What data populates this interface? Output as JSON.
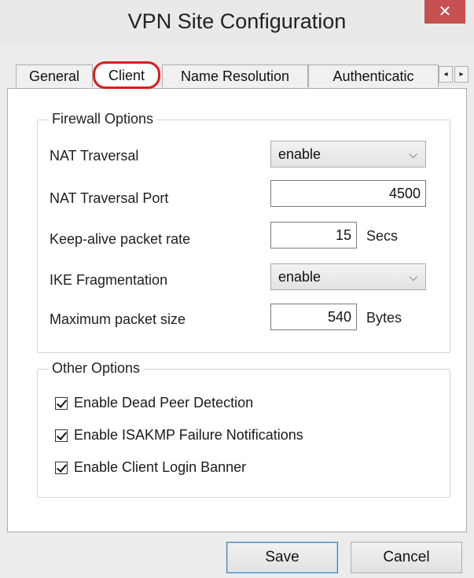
{
  "window": {
    "title": "VPN Site Configuration",
    "close_glyph": "✕"
  },
  "tabs": [
    {
      "label": "General"
    },
    {
      "label": "Client"
    },
    {
      "label": "Name Resolution"
    },
    {
      "label": "Authenticatic"
    }
  ],
  "tab_scroll": {
    "left": "◂",
    "right": "▸"
  },
  "firewall": {
    "legend": "Firewall Options",
    "nat_traversal": {
      "label": "NAT Traversal",
      "value": "enable"
    },
    "nat_traversal_port": {
      "label": "NAT Traversal Port",
      "value": "4500"
    },
    "keepalive": {
      "label": "Keep-alive packet rate",
      "value": "15",
      "unit": "Secs"
    },
    "ike_fragmentation": {
      "label": "IKE Fragmentation",
      "value": "enable"
    },
    "max_packet": {
      "label": "Maximum packet size",
      "value": "540",
      "unit": "Bytes"
    }
  },
  "other": {
    "legend": "Other Options",
    "checks": [
      {
        "label": "Enable Dead Peer Detection",
        "checked": true
      },
      {
        "label": "Enable ISAKMP Failure Notifications",
        "checked": true
      },
      {
        "label": "Enable Client Login Banner",
        "checked": true
      }
    ]
  },
  "buttons": {
    "save": "Save",
    "cancel": "Cancel"
  },
  "icons": {
    "chevron": "⌵"
  },
  "colors": {
    "highlight": "#e0191c",
    "close": "#c75050",
    "default_button_border": "#3c7fb1"
  }
}
